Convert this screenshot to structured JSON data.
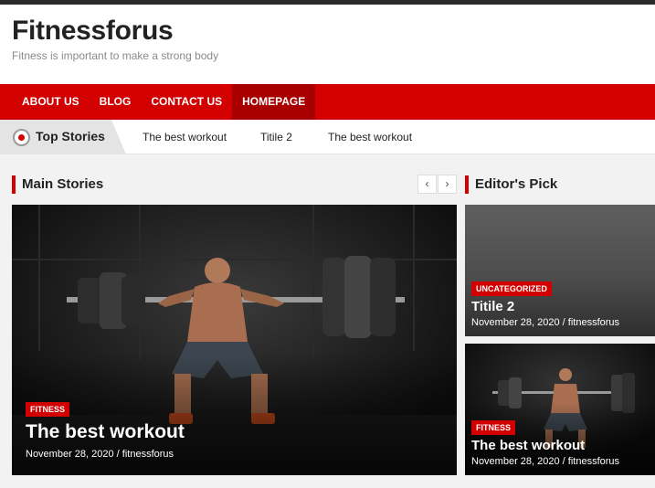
{
  "site": {
    "title": "Fitnessforus",
    "tagline": "Fitness is important to make a strong body"
  },
  "nav": {
    "items": [
      {
        "label": "ABOUT US"
      },
      {
        "label": "BLOG"
      },
      {
        "label": "CONTACT US"
      },
      {
        "label": "HOMEPAGE"
      }
    ],
    "active": "HOMEPAGE"
  },
  "ticker": {
    "label": "Top Stories",
    "links": [
      "The best workout",
      "Titile 2",
      "The best workout"
    ]
  },
  "main_stories": {
    "heading": "Main Stories",
    "prev": "‹",
    "next": "›",
    "featured": {
      "category": "FITNESS",
      "title": "The best workout",
      "meta": "November 28, 2020 / fitnessforus"
    }
  },
  "editors_pick": {
    "heading": "Editor's Pick",
    "items": [
      {
        "category": "UNCATEGORIZED",
        "title": "Titile 2",
        "meta": "November 28, 2020 / fitnessforus"
      },
      {
        "category": "FITNESS",
        "title": "The best workout",
        "meta": "November 28, 2020 / fitnessforus"
      }
    ]
  },
  "colors": {
    "accent": "#d20000",
    "nav_active": "#a80000",
    "text": "#222222",
    "muted": "#8a8a8a"
  }
}
